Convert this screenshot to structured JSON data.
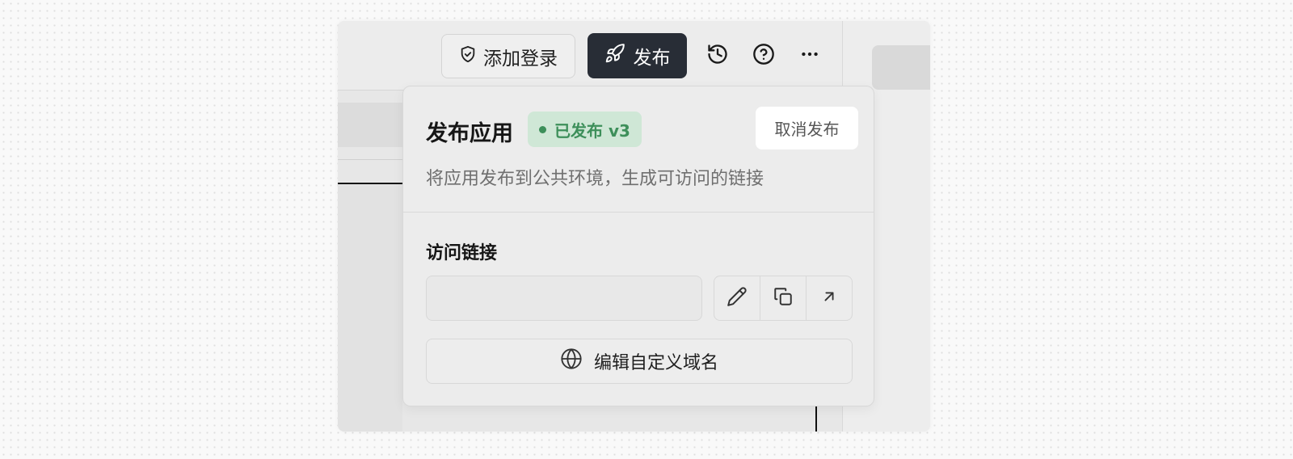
{
  "toolbar": {
    "add_login_label": "添加登录",
    "publish_label": "发布",
    "icons": [
      "shield-check-icon",
      "rocket-icon",
      "history-icon",
      "help-icon",
      "more-icon"
    ]
  },
  "publish_popover": {
    "title": "发布应用",
    "status_badge": "已发布 v3",
    "status_color": "#3d8f5a",
    "unpublish_label": "取消发布",
    "description": "将应用发布到公共环境，生成可访问的链接",
    "access_link_label": "访问链接",
    "url_value": "",
    "actions": [
      "edit-icon",
      "copy-icon",
      "open-external-icon"
    ],
    "custom_domain_label": "编辑自定义域名"
  },
  "colors": {
    "publish_button_bg": "#282d36",
    "badge_bg": "#cfe7d6"
  }
}
